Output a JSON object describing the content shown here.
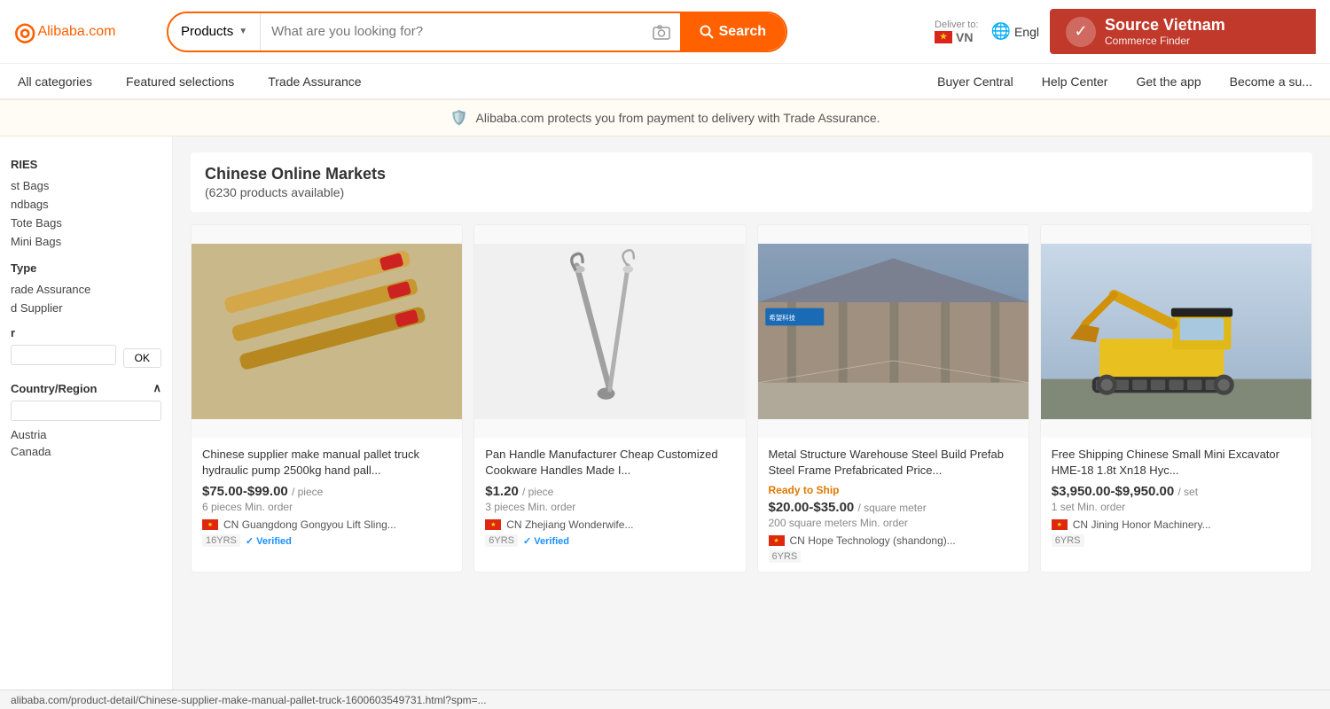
{
  "header": {
    "logo": "Alibaba.com",
    "search_dropdown": "Products",
    "search_placeholder": "What are you looking for?",
    "search_button": "Search",
    "deliver_label": "Deliver to:",
    "deliver_country": "VN",
    "language": "Engl",
    "source_vietnam_title": "Source Vietnam",
    "source_vietnam_subtitle": "Commerce Finder"
  },
  "nav": {
    "items": [
      {
        "label": "All categories"
      },
      {
        "label": "Featured selections"
      },
      {
        "label": "Trade Assurance"
      }
    ],
    "right_items": [
      {
        "label": "Buyer Central"
      },
      {
        "label": "Help Center"
      },
      {
        "label": "Get the app"
      },
      {
        "label": "Become a su..."
      }
    ]
  },
  "trade_banner": {
    "text": "Alibaba.com protects you from payment to delivery with Trade Assurance."
  },
  "sidebar": {
    "categories_label": "RIES",
    "items": [
      {
        "label": "st Bags"
      },
      {
        "label": "ndbags"
      },
      {
        "label": "Tote Bags"
      },
      {
        "label": "Mini Bags"
      }
    ],
    "type_label": "Type",
    "type_items": [
      {
        "label": "rade Assurance"
      },
      {
        "label": "d Supplier"
      }
    ],
    "filter_label": "r",
    "filter_ok": "OK",
    "country_label": "Country/Region",
    "country_items": [
      {
        "label": "Austria"
      },
      {
        "label": "Canada"
      }
    ]
  },
  "market": {
    "title": "Chinese Online Markets",
    "subtitle": "(6230 products available)"
  },
  "products": [
    {
      "id": 1,
      "title": "Chinese supplier make manual pallet truck hydraulic pump 2500kg hand pall...",
      "price": "$75.00-$99.00",
      "price_unit": "/ piece",
      "moq": "6 pieces Min. order",
      "ready_to_ship": false,
      "supplier_country": "CN",
      "supplier_name": "Guangdong Gongyou Lift Sling...",
      "years": "16YRS",
      "verified": true,
      "image_type": "pallet_truck"
    },
    {
      "id": 2,
      "title": "Pan Handle Manufacturer Cheap Customized Cookware Handles Made I...",
      "price": "$1.20",
      "price_unit": "/ piece",
      "moq": "3 pieces Min. order",
      "ready_to_ship": false,
      "supplier_country": "CN",
      "supplier_name": "Zhejiang Wonderwife...",
      "years": "6YRS",
      "verified": true,
      "image_type": "pan_handle"
    },
    {
      "id": 3,
      "title": "Metal Structure Warehouse Steel Build Prefab Steel Frame Prefabricated Price...",
      "price": "$20.00-$35.00",
      "price_unit": "/ square meter",
      "moq": "200 square meters Min. order",
      "ready_to_ship": true,
      "ready_label": "Ready to Ship",
      "supplier_country": "CN",
      "supplier_name": "Hope Technology (shandong)...",
      "years": "6YRS",
      "verified": false,
      "image_type": "warehouse"
    },
    {
      "id": 4,
      "title": "Free Shipping Chinese Small Mini Excavator HME-18 1.8t Xn18 Hyc...",
      "price": "$3,950.00-$9,950.00",
      "price_unit": "/ set",
      "moq": "1 set Min. order",
      "ready_to_ship": false,
      "supplier_country": "CN",
      "supplier_name": "Jining Honor Machinery...",
      "years": "6YRS",
      "verified": false,
      "image_type": "excavator"
    }
  ],
  "url_bar": {
    "text": "alibaba.com/product-detail/Chinese-supplier-make-manual-pallet-truck-1600603549731.html?spm=..."
  }
}
